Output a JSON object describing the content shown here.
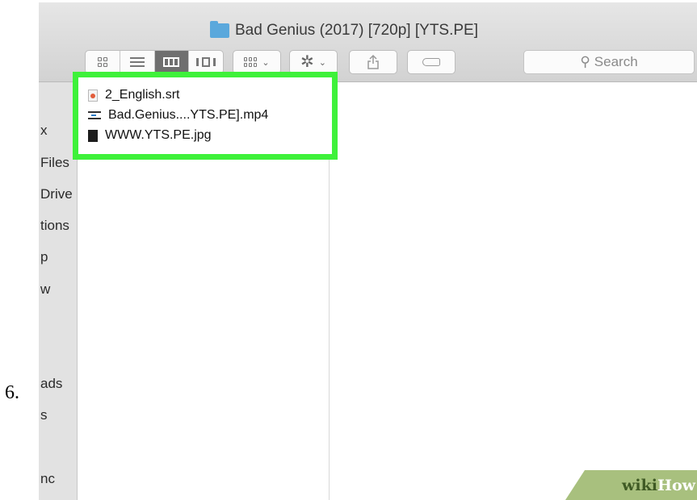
{
  "step_number": "6.",
  "window": {
    "title": "Bad Genius (2017) [720p] [YTS.PE]",
    "title_icon": "folder-icon"
  },
  "toolbar": {
    "view_buttons": [
      "icon-view-icon",
      "list-view-icon",
      "column-view-icon",
      "cover-flow-icon"
    ],
    "active_view": "column-view-icon",
    "arrange_icon": "arrange-grid-icon",
    "action_icon": "gear-icon",
    "share_icon": "share-icon",
    "tags_icon": "tag-icon",
    "search_placeholder": "Search"
  },
  "sidebar": {
    "items": [
      "x",
      "Files",
      "Drive",
      "tions",
      "p",
      "w",
      "ads",
      "s",
      "nc"
    ]
  },
  "files": [
    {
      "name": "2_English.srt",
      "icon": "subtitle-file-icon"
    },
    {
      "name": "Bad.Genius....YTS.PE].mp4",
      "icon": "video-file-icon"
    },
    {
      "name": "WWW.YTS.PE.jpg",
      "icon": "image-file-icon"
    }
  ],
  "highlight_color": "#3ef13a",
  "watermark": {
    "wiki": "wiki",
    "how": "How"
  }
}
